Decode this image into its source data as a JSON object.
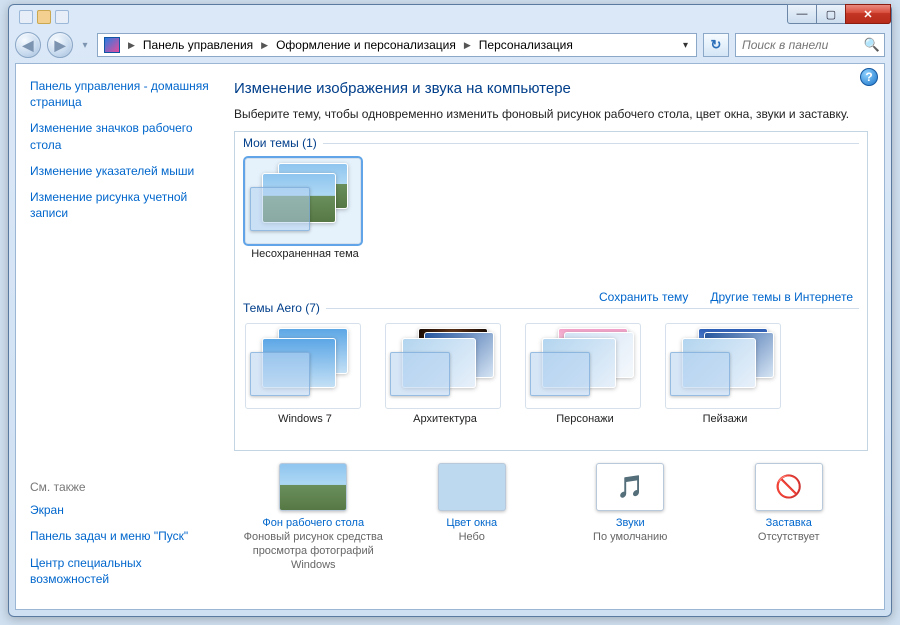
{
  "titlebar": {
    "title": ""
  },
  "win": {
    "min": "—",
    "max": "▢",
    "close": "✕"
  },
  "nav": {
    "back": "◀",
    "forward": "▶",
    "segments": [
      "Панель управления",
      "Оформление и персонализация",
      "Персонализация"
    ],
    "search_placeholder": "Поиск в панели"
  },
  "sidebar": {
    "links": [
      "Панель управления - домашняя страница",
      "Изменение значков рабочего стола",
      "Изменение указателей мыши",
      "Изменение рисунка учетной записи"
    ],
    "seealso_label": "См. также",
    "seealso": [
      "Экран",
      "Панель задач и меню \"Пуск\"",
      "Центр специальных возможностей"
    ]
  },
  "main": {
    "heading": "Изменение изображения и звука на компьютере",
    "subtext": "Выберите тему, чтобы одновременно изменить фоновый рисунок рабочего стола, цвет окна, звуки и заставку.",
    "my_themes_label": "Мои темы (1)",
    "my_themes": [
      {
        "caption": "Несохраненная тема",
        "selected": true
      }
    ],
    "save_link": "Сохранить тему",
    "more_link": "Другие темы в Интернете",
    "aero_label": "Темы Aero (7)",
    "aero_themes": [
      {
        "caption": "Windows 7"
      },
      {
        "caption": "Архитектура"
      },
      {
        "caption": "Персонажи"
      },
      {
        "caption": "Пейзажи"
      }
    ],
    "options": [
      {
        "title": "Фон рабочего стола",
        "desc": "Фоновый рисунок средства просмотра фотографий Windows"
      },
      {
        "title": "Цвет окна",
        "desc": "Небо"
      },
      {
        "title": "Звуки",
        "desc": "По умолчанию"
      },
      {
        "title": "Заставка",
        "desc": "Отсутствует"
      }
    ]
  }
}
